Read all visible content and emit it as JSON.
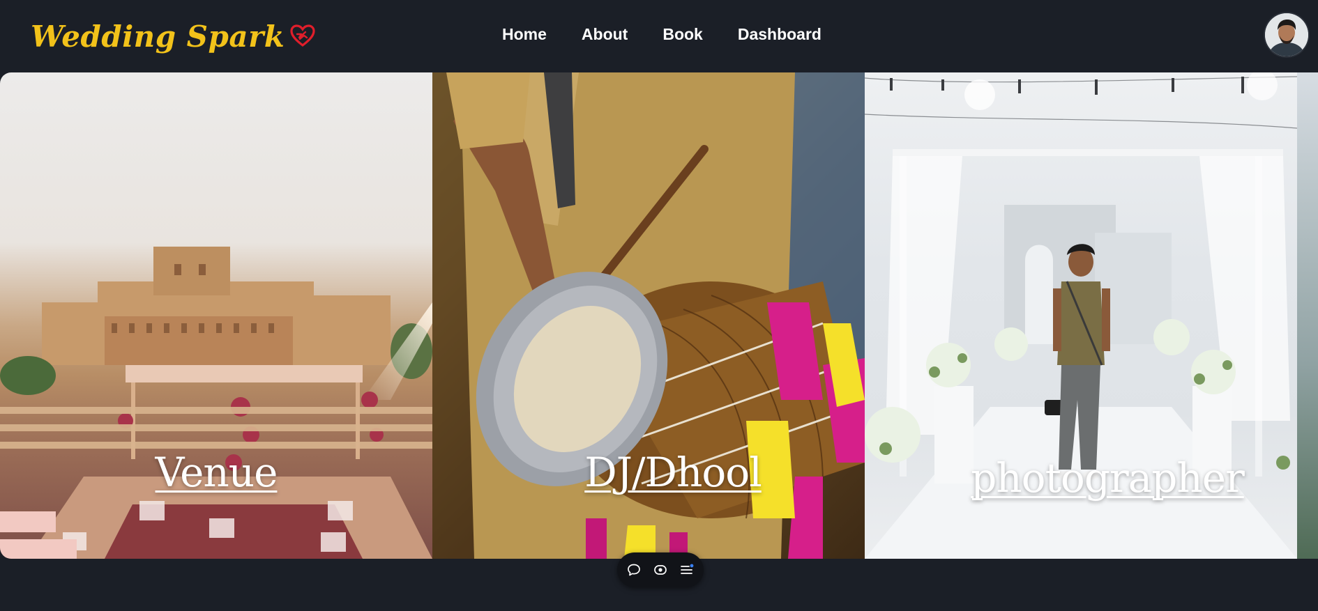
{
  "app": {
    "brand_name": "Wedding Spark",
    "brand_color": "#f2c21a",
    "heart_color": "#e01e2b",
    "background": "#1b1f27"
  },
  "nav": {
    "items": [
      {
        "label": "Home"
      },
      {
        "label": "About"
      },
      {
        "label": "Book"
      },
      {
        "label": "Dashboard"
      }
    ]
  },
  "user": {
    "avatar_icon": "user-avatar"
  },
  "categories": [
    {
      "title": "Venue",
      "image": "palace-venue-photo"
    },
    {
      "title": "DJ/Dhool",
      "image": "dhol-drummer-photo"
    },
    {
      "title": "photographer",
      "image": "wedding-photographer-photo"
    }
  ],
  "toolbar": {
    "icons": [
      "comment-icon",
      "eye-icon",
      "menu-list-icon"
    ]
  }
}
